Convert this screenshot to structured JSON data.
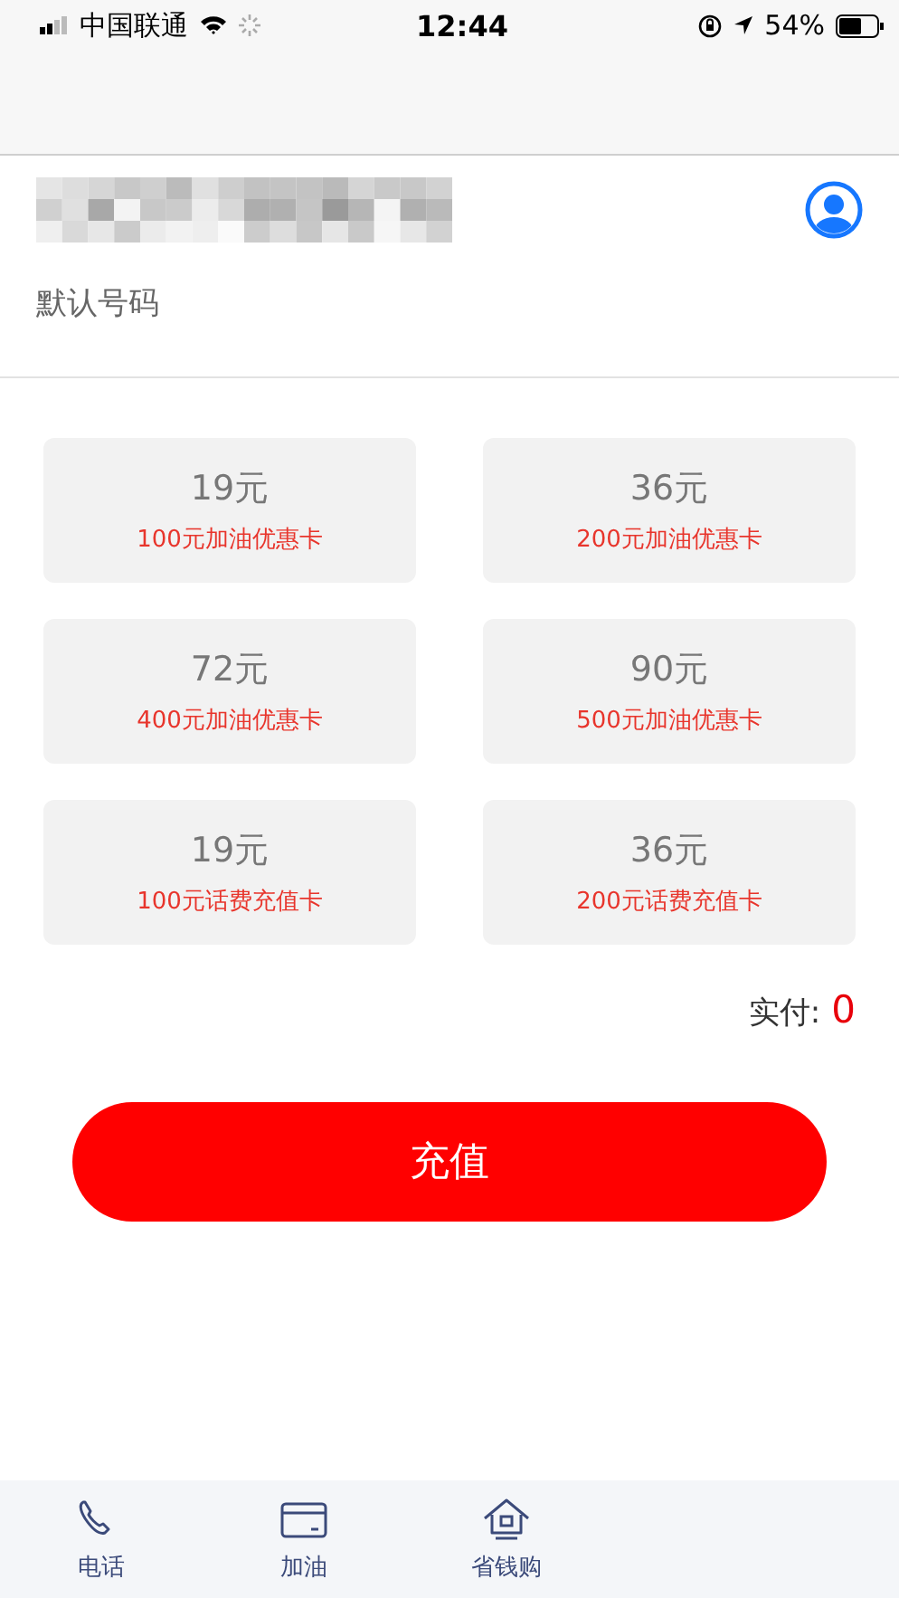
{
  "status_bar": {
    "carrier": "中国联通",
    "time": "12:44",
    "battery": "54%"
  },
  "account": {
    "label": "默认号码"
  },
  "cards": [
    {
      "price": "19元",
      "description": "100元加油优惠卡"
    },
    {
      "price": "36元",
      "description": "200元加油优惠卡"
    },
    {
      "price": "72元",
      "description": "400元加油优惠卡"
    },
    {
      "price": "90元",
      "description": "500元加油优惠卡"
    },
    {
      "price": "19元",
      "description": "100元话费充值卡"
    },
    {
      "price": "36元",
      "description": "200元话费充值卡"
    }
  ],
  "total": {
    "label": "实付:",
    "amount": "0"
  },
  "button": "充值",
  "tabs": [
    {
      "label": "电话",
      "kind": "phone"
    },
    {
      "label": "加油",
      "kind": "card"
    },
    {
      "label": "省钱购",
      "kind": "home"
    }
  ]
}
